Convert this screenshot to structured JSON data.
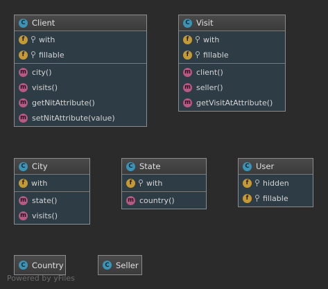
{
  "classes": {
    "client": {
      "name": "Client",
      "kind": "C",
      "fields": [
        {
          "kind": "f",
          "name": "with"
        },
        {
          "kind": "f",
          "name": "fillable"
        }
      ],
      "methods": [
        "city()",
        "visits()",
        "getNitAttribute()",
        "setNitAttribute(value)"
      ]
    },
    "visit": {
      "name": "Visit",
      "kind": "C",
      "fields": [
        {
          "kind": "f",
          "name": "with"
        },
        {
          "kind": "f",
          "name": "fillable"
        }
      ],
      "methods": [
        "client()",
        "seller()",
        "getVisitAtAttribute()"
      ]
    },
    "city": {
      "name": "City",
      "kind": "C",
      "fields": [
        {
          "kind": "f",
          "name": "with"
        }
      ],
      "methods": [
        "state()",
        "visits()"
      ]
    },
    "state": {
      "name": "State",
      "kind": "C",
      "fields": [
        {
          "kind": "f",
          "name": "with"
        }
      ],
      "methods": [
        "country()"
      ]
    },
    "user": {
      "name": "User",
      "kind": "C",
      "fields": [
        {
          "kind": "f",
          "name": "hidden"
        },
        {
          "kind": "f",
          "name": "fillable"
        }
      ],
      "methods": []
    },
    "country": {
      "name": "Country",
      "kind": "C"
    },
    "seller": {
      "name": "Seller",
      "kind": "C"
    }
  },
  "method_badge": "m",
  "watermark": "Powered by yFiles",
  "colors": {
    "background": "#2b2b2b",
    "box": "#2e3d45",
    "class_badge": "#3d93b5",
    "field_badge": "#c49a36",
    "method_badge": "#b55a82"
  }
}
